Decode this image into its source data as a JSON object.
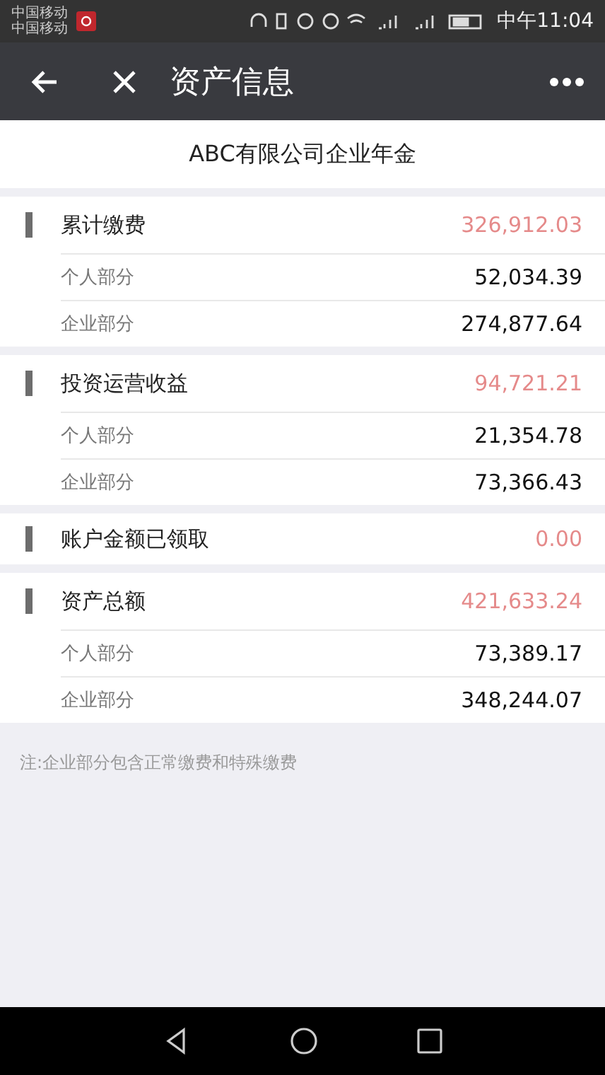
{
  "status_bar": {
    "carriers": [
      "中国移动",
      "中国移动"
    ],
    "time": "中午11:04"
  },
  "nav": {
    "title": "资产信息"
  },
  "company": "ABC有限公司企业年金",
  "sections": [
    {
      "label": "累计缴费",
      "value": "326,912.03",
      "rows": [
        {
          "label": "个人部分",
          "value": "52,034.39"
        },
        {
          "label": "企业部分",
          "value": "274,877.64"
        }
      ]
    },
    {
      "label": "投资运营收益",
      "value": "94,721.21",
      "rows": [
        {
          "label": "个人部分",
          "value": "21,354.78"
        },
        {
          "label": "企业部分",
          "value": "73,366.43"
        }
      ]
    },
    {
      "label": "账户金额已领取",
      "value": "0.00"
    },
    {
      "label": "资产总额",
      "value": "421,633.24",
      "rows": [
        {
          "label": "个人部分",
          "value": "73,389.17"
        },
        {
          "label": "企业部分",
          "value": "348,244.07"
        }
      ]
    }
  ],
  "note": "注:企业部分包含正常缴费和特殊缴费"
}
